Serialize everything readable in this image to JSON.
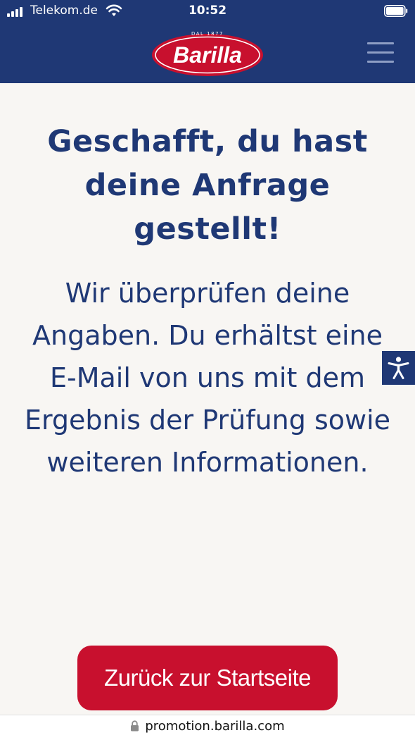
{
  "status_bar": {
    "carrier": "Telekom.de",
    "time": "10:52"
  },
  "header": {
    "logo_text": "Barilla",
    "logo_tagline": "DAL 1877"
  },
  "main": {
    "headline": "Geschafft, du hast deine Anfrage gestellt!",
    "message": "Wir überprüfen deine Angaben. Du erhältst eine E-Mail von uns mit dem Ergebnis der Prüfung sowie weiteren Informationen."
  },
  "cta": {
    "label": "Zurück zur Startseite"
  },
  "url_bar": {
    "url": "promotion.barilla.com"
  },
  "colors": {
    "brand_blue": "#1f3875",
    "brand_red": "#c8102e",
    "background": "#f8f6f3"
  },
  "icons": {
    "menu": "hamburger-menu-icon",
    "accessibility": "accessibility-icon",
    "lock": "lock-icon",
    "wifi": "wifi-icon",
    "battery": "battery-icon",
    "signal": "signal-icon"
  }
}
